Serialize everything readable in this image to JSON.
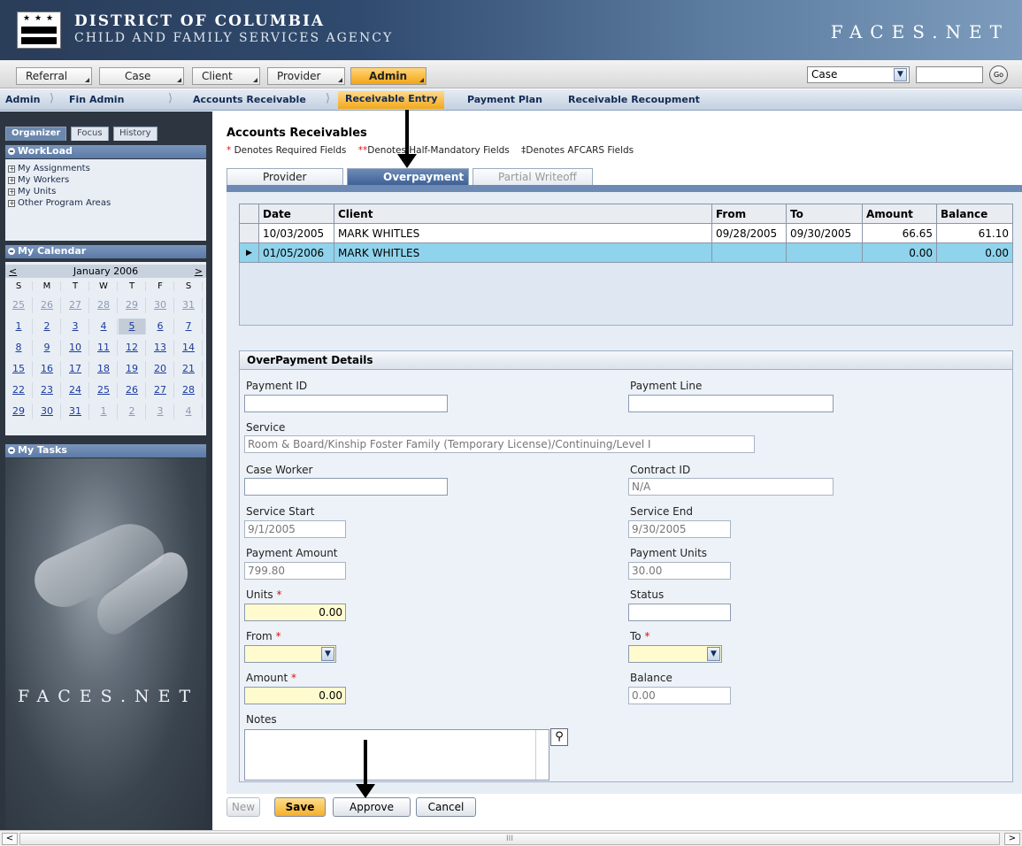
{
  "header": {
    "agency_line1": "DISTRICT OF COLUMBIA",
    "agency_line2": "CHILD AND FAMILY SERVICES AGENCY",
    "brand": "FACES.NET"
  },
  "top_nav": {
    "items": [
      "Referral",
      "Case",
      "Client",
      "Provider",
      "Admin"
    ],
    "active": "Admin",
    "search_type": "Case",
    "go_label": "Go"
  },
  "breadcrumbs": {
    "items": [
      "Admin",
      "Fin Admin",
      "Accounts Receivable",
      "Receivable Entry",
      "Payment Plan",
      "Receivable Recoupment"
    ],
    "active": "Receivable Entry"
  },
  "sidebar": {
    "tabs": [
      "Organizer",
      "Focus",
      "History"
    ],
    "workload_title": "WorkLoad",
    "workload_items": [
      "My Assignments",
      "My Workers",
      "My Units",
      "Other Program Areas"
    ],
    "calendar_title": "My Calendar",
    "calendar_month": "January 2006",
    "calendar_prev": "<",
    "calendar_next": ">",
    "weekdays": [
      "S",
      "M",
      "T",
      "W",
      "T",
      "F",
      "S"
    ],
    "weeks": [
      [
        "25",
        "26",
        "27",
        "28",
        "29",
        "30",
        "31"
      ],
      [
        "1",
        "2",
        "3",
        "4",
        "5",
        "6",
        "7"
      ],
      [
        "8",
        "9",
        "10",
        "11",
        "12",
        "13",
        "14"
      ],
      [
        "15",
        "16",
        "17",
        "18",
        "19",
        "20",
        "21"
      ],
      [
        "22",
        "23",
        "24",
        "25",
        "26",
        "27",
        "28"
      ],
      [
        "29",
        "30",
        "31",
        "1",
        "2",
        "3",
        "4"
      ]
    ],
    "today": "5",
    "tasks_title": "My Tasks",
    "brand": "FACES.NET"
  },
  "main": {
    "title": "Accounts Receivables",
    "legend": {
      "required_mark": "*",
      "required": "Denotes Required Fields",
      "half_mark": "**",
      "half": "Denotes Half-Mandatory Fields",
      "afcars_mark": "‡",
      "afcars": "Denotes AFCARS Fields"
    },
    "tabs": [
      "Provider",
      "Overpayment",
      "Partial Writeoff"
    ],
    "active_tab": "Overpayment",
    "table": {
      "columns": [
        "Date",
        "Client",
        "From",
        "To",
        "Amount",
        "Balance"
      ],
      "rows": [
        [
          "10/03/2005",
          "MARK WHITLES",
          "09/28/2005",
          "09/30/2005",
          "66.65",
          "61.10"
        ],
        [
          "01/05/2006",
          "MARK WHITLES",
          "",
          "",
          "0.00",
          "0.00"
        ]
      ],
      "selected_row": 1,
      "row_indicator": "▶"
    },
    "details": {
      "title": "OverPayment Details",
      "payment_id_label": "Payment ID",
      "payment_id": "",
      "payment_line_label": "Payment Line",
      "payment_line": "",
      "service_label": "Service",
      "service": "Room & Board/Kinship Foster Family (Temporary License)/Continuing/Level I",
      "case_worker_label": "Case Worker",
      "case_worker": "",
      "contract_id_label": "Contract ID",
      "contract_id": "N/A",
      "service_start_label": "Service Start",
      "service_start": "9/1/2005",
      "service_end_label": "Service End",
      "service_end": "9/30/2005",
      "payment_amount_label": "Payment Amount",
      "payment_amount": "799.80",
      "payment_units_label": "Payment Units",
      "payment_units": "30.00",
      "units_label": "Units",
      "units": "0.00",
      "status_label": "Status",
      "status": "",
      "from_label": "From",
      "from": "",
      "to_label": "To",
      "to": "",
      "amount_label": "Amount",
      "amount": "0.00",
      "balance_label": "Balance",
      "balance": "0.00",
      "notes_label": "Notes",
      "notes": ""
    },
    "buttons": {
      "new": "New",
      "save": "Save",
      "approve": "Approve",
      "cancel": "Cancel"
    }
  },
  "scrollbar": {
    "thumb_grip": "III"
  },
  "colors": {
    "accent": "#f4a514",
    "selected_row": "#8fd3ec",
    "required_field": "#fffbcf",
    "header_dark": "#2a3d59"
  }
}
